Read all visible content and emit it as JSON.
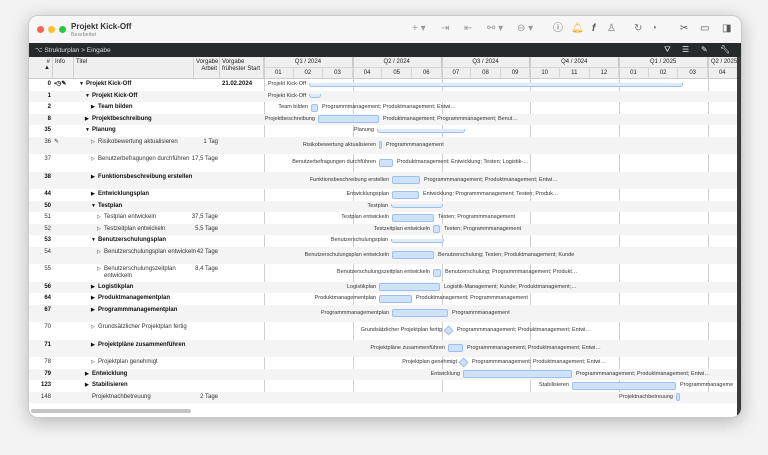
{
  "window": {
    "title": "Projekt Kick-Off",
    "subtitle": "Bearbeitet"
  },
  "toolbar": {
    "icons": [
      "plus-icon",
      "indent-icon",
      "outdent-icon",
      "link-icon",
      "more-icon",
      "help-icon",
      "bell-icon",
      "formula-icon",
      "person-icon",
      "refresh-icon",
      "gauge-icon",
      "tools-icon",
      "panel-bottom-icon",
      "panel-right-icon"
    ],
    "bell_color": "#f5a623"
  },
  "breadcrumb": {
    "root": "Strukturplan",
    "sep": ">",
    "current": "Eingabe"
  },
  "columns": {
    "num": "#",
    "info": "Info",
    "title": "Titel",
    "work": "Vorgabe Arbeit",
    "start": "Vorgabe frühester Start"
  },
  "timeline": {
    "quarters": [
      "Q1 / 2024",
      "Q2 / 2024",
      "Q3 / 2024",
      "Q4 / 2024",
      "Q1 / 2025",
      "Q2 / 2025"
    ],
    "months": [
      "01",
      "02",
      "03",
      "04",
      "05",
      "06",
      "07",
      "08",
      "09",
      "10",
      "11",
      "12",
      "01",
      "02",
      "03",
      "04"
    ]
  },
  "colors": {
    "bar_fill": "#cfe2fb",
    "bar_border": "#9cc0ee"
  },
  "rows": [
    {
      "id": "0",
      "info": "▪◷✎",
      "title": "Projekt Kick-Off",
      "work": "",
      "start": "21.02.2024",
      "level": 0,
      "icon": "▼",
      "bold": true,
      "g_label": "Projekt Kick-Off",
      "g_res": ""
    },
    {
      "id": "1",
      "info": "",
      "title": "Projekt Kick-Off",
      "work": "",
      "start": "",
      "level": 1,
      "icon": "▼",
      "bold": true,
      "g_label": "Projekt Kick-Off",
      "g_res": ""
    },
    {
      "id": "2",
      "info": "",
      "title": "Team bilden",
      "work": "",
      "start": "",
      "level": 2,
      "icon": "▶",
      "bold": true,
      "g_label": "Team bilden",
      "g_res": "Programmmanagement; Produktmanagement; Entwi…"
    },
    {
      "id": "8",
      "info": "",
      "title": "Projektbeschreibung",
      "work": "",
      "start": "",
      "level": 1,
      "icon": "▶",
      "bold": true,
      "g_label": "Projektbeschreibung",
      "g_res": "Produktmanagement; Programmmanagement; Benut…"
    },
    {
      "id": "35",
      "info": "",
      "title": "Planung",
      "work": "",
      "start": "",
      "level": 1,
      "icon": "▼",
      "bold": true,
      "g_label": "Planung",
      "g_res": ""
    },
    {
      "id": "36",
      "info": "✎",
      "title": "Risikobewertung aktualisieren",
      "work": "1 Tag",
      "start": "",
      "level": 2,
      "icon": "▷",
      "bold": false,
      "g_label": "Risikobewertung aktualisieren",
      "g_res": "Programmmanagement"
    },
    {
      "id": "37",
      "info": "",
      "title": "Benutzerbefragungen durchführen",
      "work": "17,5 Tage",
      "start": "",
      "level": 2,
      "icon": "▷",
      "bold": false,
      "g_label": "Benutzerbefragungen durchführen",
      "g_res": "Produktmanagement; Entwicklung; Testen; Logistik-…"
    },
    {
      "id": "38",
      "info": "",
      "title": "Funktionsbeschreibung erstellen",
      "work": "",
      "start": "",
      "level": 2,
      "icon": "▶",
      "bold": true,
      "g_label": "Funktionsbeschreibung erstellen",
      "g_res": "Programmmanagement; Produktmanagement; Entwi…"
    },
    {
      "id": "44",
      "info": "",
      "title": "Entwicklungsplan",
      "work": "",
      "start": "",
      "level": 2,
      "icon": "▶",
      "bold": true,
      "g_label": "Entwicklungsplan",
      "g_res": "Entwicklung; Programmmanagement; Testen; Produk…"
    },
    {
      "id": "50",
      "info": "",
      "title": "Testplan",
      "work": "",
      "start": "",
      "level": 2,
      "icon": "▼",
      "bold": true,
      "g_label": "Testplan",
      "g_res": ""
    },
    {
      "id": "51",
      "info": "",
      "title": "Testplan entwickeln",
      "work": "37,5 Tage",
      "start": "",
      "level": 3,
      "icon": "▷",
      "bold": false,
      "g_label": "Testplan entwickeln",
      "g_res": "Testen; Programmmanagement"
    },
    {
      "id": "52",
      "info": "",
      "title": "Testzeitplan entwickeln",
      "work": "5,5 Tage",
      "start": "",
      "level": 3,
      "icon": "▷",
      "bold": false,
      "g_label": "Testzeitplan entwickeln",
      "g_res": "Testen; Programmmanagement"
    },
    {
      "id": "53",
      "info": "",
      "title": "Benutzerschulungsplan",
      "work": "",
      "start": "",
      "level": 2,
      "icon": "▼",
      "bold": true,
      "g_label": "Benutzerschulungsplan",
      "g_res": ""
    },
    {
      "id": "54",
      "info": "",
      "title": "Benutzerschulungsplan entwickeln",
      "work": "42 Tage",
      "start": "",
      "level": 3,
      "icon": "▷",
      "bold": false,
      "g_label": "Benutzerschulungsplan entwickeln",
      "g_res": "Benutzerschulung; Testen; Produktmanagement; Kunde"
    },
    {
      "id": "55",
      "info": "",
      "title": "Benutzerschulungszeitplan entwickeln",
      "work": "8,4 Tage",
      "start": "",
      "level": 3,
      "icon": "▷",
      "bold": false,
      "g_label": "Benutzerschulungszeitplan entwickeln",
      "g_res": "Benutzerschulung; Programmmanagement; Produkt…"
    },
    {
      "id": "56",
      "info": "",
      "title": "Logistikplan",
      "work": "",
      "start": "",
      "level": 2,
      "icon": "▶",
      "bold": true,
      "g_label": "Logistikplan",
      "g_res": "Logistik-Management; Kunde; Produktmanagement;…"
    },
    {
      "id": "64",
      "info": "",
      "title": "Produktmanagementplan",
      "work": "",
      "start": "",
      "level": 2,
      "icon": "▶",
      "bold": true,
      "g_label": "Produktmanagementplan",
      "g_res": "Produktmanagement; Programmmanagement"
    },
    {
      "id": "67",
      "info": "",
      "title": "Programmmanagementplan",
      "work": "",
      "start": "",
      "level": 2,
      "icon": "▶",
      "bold": true,
      "g_label": "Programmmanagementplan",
      "g_res": "Programmmanagement"
    },
    {
      "id": "70",
      "info": "",
      "title": "Grundsätzlicher Projektplan fertig",
      "work": "",
      "start": "",
      "level": 2,
      "icon": "▷",
      "bold": false,
      "g_label": "Grundsätzlicher Projektplan fertig",
      "g_res": "Programmmanagement; Produktmanagement; Entwi…"
    },
    {
      "id": "71",
      "info": "",
      "title": "Projektpläne zusammenführen",
      "work": "",
      "start": "",
      "level": 2,
      "icon": "▶",
      "bold": true,
      "g_label": "Projektpläne zusammenführen",
      "g_res": "Programmmanagement; Produktmanagement; Entwi…"
    },
    {
      "id": "78",
      "info": "",
      "title": "Projektplan genehmigt",
      "work": "",
      "start": "",
      "level": 2,
      "icon": "▷",
      "bold": false,
      "g_label": "Projektplan genehmigt",
      "g_res": "Programmmanagement; Produktmanagement; Entwi…"
    },
    {
      "id": "79",
      "info": "",
      "title": "Entwicklung",
      "work": "",
      "start": "",
      "level": 1,
      "icon": "▶",
      "bold": true,
      "g_label": "Entwicklung",
      "g_res": "Programmmanagement; Produktmanagement; Entwi…"
    },
    {
      "id": "123",
      "info": "",
      "title": "Stabilisieren",
      "work": "",
      "start": "",
      "level": 1,
      "icon": "▶",
      "bold": true,
      "g_label": "Stabilisieren",
      "g_res": "Programmmanageme"
    },
    {
      "id": "148",
      "info": "",
      "title": "Projektnachbetreuung",
      "work": "2 Tage",
      "start": "",
      "level": 1,
      "icon": "",
      "bold": false,
      "g_label": "Projektnachbetreuung",
      "g_res": ""
    }
  ]
}
